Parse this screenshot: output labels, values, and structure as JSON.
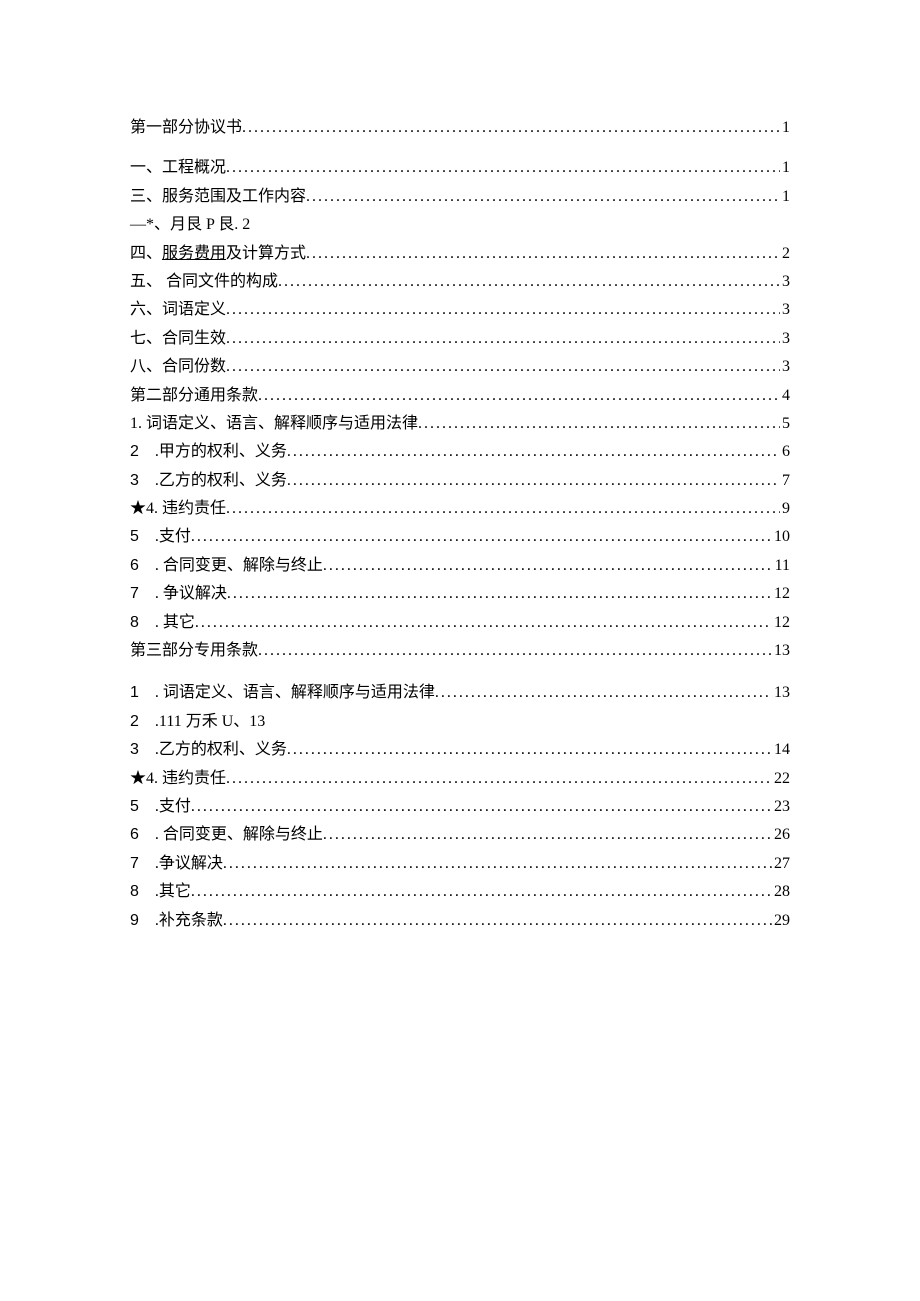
{
  "toc": {
    "entries": [
      {
        "type": "leader",
        "label": "第一部分协议书",
        "page": "1",
        "classExtra": "toc-section-top"
      },
      {
        "type": "leader",
        "label": "一、工程概况",
        "page": "1"
      },
      {
        "type": "leader",
        "label": "三、服务范围及工作内容",
        "page": "1"
      },
      {
        "type": "plain",
        "label": "—*、月艮 P 艮. 2"
      },
      {
        "type": "leader",
        "prefix": "四、",
        "underlined": "服务费用",
        "suffix": "及计算方式",
        "page": "2"
      },
      {
        "type": "leader",
        "label": "五、 合同文件的构成",
        "page": "3"
      },
      {
        "type": "leader",
        "label": "六、词语定义",
        "page": "3"
      },
      {
        "type": "leader",
        "label": "七、合同生效",
        "page": "3"
      },
      {
        "type": "leader",
        "label": "八、合同份数",
        "page": "3"
      },
      {
        "type": "leader",
        "label": "第二部分通用条款",
        "page": "4"
      },
      {
        "type": "leader",
        "label": "1. 词语定义、语言、解释顺序与适用法律",
        "page": "5"
      },
      {
        "type": "leader",
        "num": "2",
        "label": ".甲方的权利、义务",
        "page": "6"
      },
      {
        "type": "leader",
        "num": "3",
        "label": ".乙方的权利、义务",
        "page": "7"
      },
      {
        "type": "leader",
        "label": "★4. 违约责任",
        "page": "9"
      },
      {
        "type": "leader",
        "num": "5",
        "label": ".支付",
        "page": "10"
      },
      {
        "type": "leader",
        "num": "6",
        "label": ". 合同变更、解除与终止 ",
        "page": "11"
      },
      {
        "type": "leader",
        "num": "7",
        "label": ". 争议解决 ",
        "page": "12"
      },
      {
        "type": "leader",
        "num": "8",
        "label": ". 其它 ",
        "page": "12"
      },
      {
        "type": "leader",
        "label": "第三部分专用条款",
        "page": "13"
      },
      {
        "type": "leader",
        "num": "1",
        "label": ". 词语定义、语言、解释顺序与适用法律 ",
        "page": "13",
        "classExtra": "section-gap"
      },
      {
        "type": "plain",
        "num": "2",
        "label": ".111 万禾 U、13"
      },
      {
        "type": "leader",
        "num": "3",
        "label": ".乙方的权利、义务",
        "page": "14"
      },
      {
        "type": "leader",
        "label": "★4. 违约责任",
        "page": "22"
      },
      {
        "type": "leader",
        "num": "5",
        "label": ".支付",
        "page": "23"
      },
      {
        "type": "leader",
        "num": "6",
        "label": ". 合同变更、解除与终止 ",
        "page": "26"
      },
      {
        "type": "leader",
        "num": "7",
        "label": ".争议解决",
        "page": "27"
      },
      {
        "type": "leader",
        "num": "8",
        "label": ".其它",
        "page": "28"
      },
      {
        "type": "leader",
        "num": "9",
        "label": ".补充条款",
        "page": "29"
      }
    ]
  }
}
